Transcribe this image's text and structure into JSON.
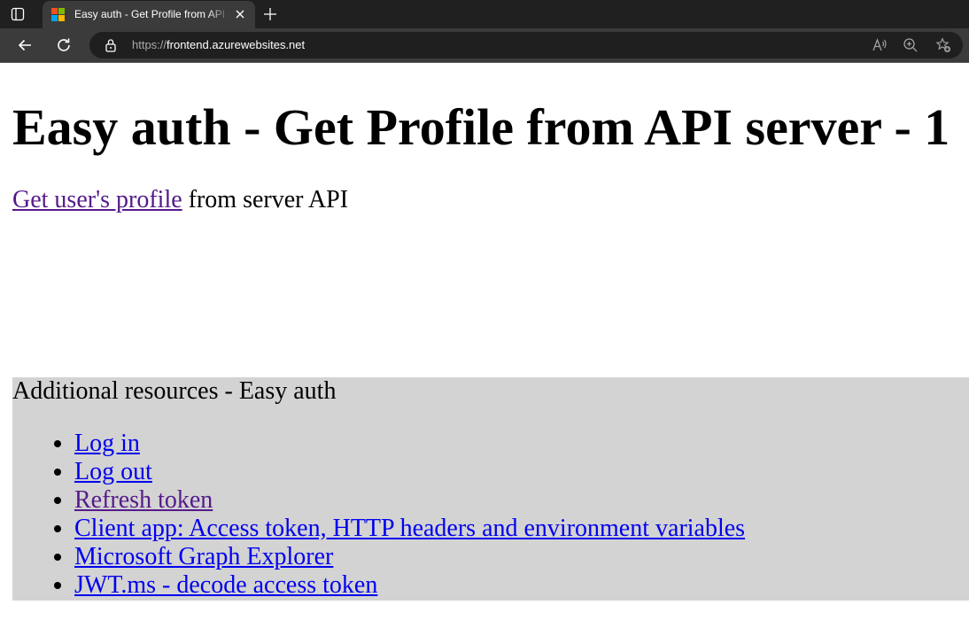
{
  "browser": {
    "tab_title": "Easy auth - Get Profile from API server - 1",
    "url_protocol": "https://",
    "url_host": "frontend.azurewebsites.net",
    "colors": {
      "tabbar": "#202020",
      "toolbar": "#3b3b3b",
      "omnibox": "#1f1f1f"
    },
    "icons": [
      "tab-actions-icon",
      "microsoft-favicon",
      "close-icon",
      "plus-icon",
      "back-arrow-icon",
      "reload-icon",
      "lock-icon",
      "read-aloud-icon",
      "zoom-icon",
      "favorites-icon"
    ]
  },
  "page": {
    "heading": "Easy auth - Get Profile from API server - 1",
    "profile_link": "Get user's profile",
    "profile_suffix": " from server API",
    "resources": {
      "title": "Additional resources - Easy auth",
      "background": "#d3d3d3",
      "links": [
        {
          "label": "Log in",
          "visited": false
        },
        {
          "label": "Log out",
          "visited": false
        },
        {
          "label": "Refresh token",
          "visited": true
        },
        {
          "label": "Client app: Access token, HTTP headers and environment variables",
          "visited": false
        },
        {
          "label": "Microsoft Graph Explorer",
          "visited": false
        },
        {
          "label": "JWT.ms - decode access token",
          "visited": false
        }
      ]
    },
    "link_color": "#0000ee",
    "visited_link_color": "#551a8b"
  }
}
